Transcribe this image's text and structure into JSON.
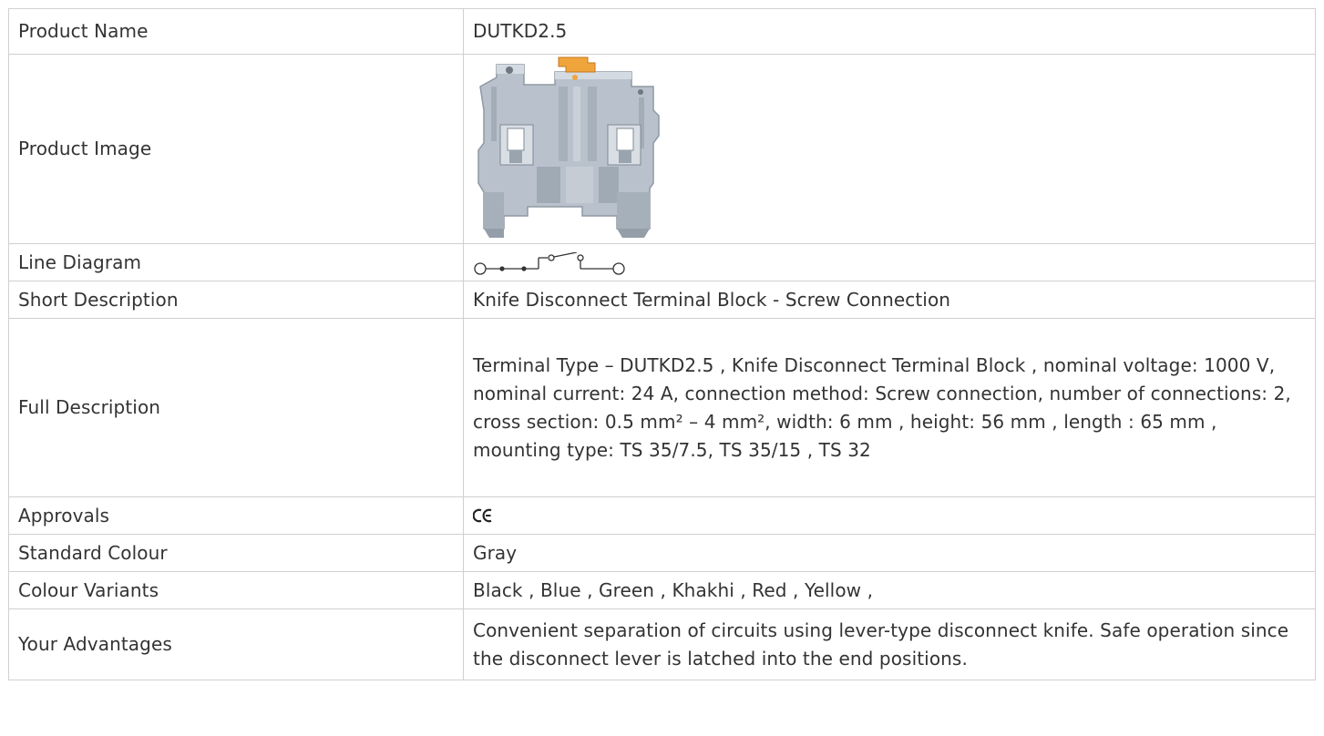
{
  "rows": [
    {
      "label": "Product Name",
      "value": "DUTKD2.5"
    },
    {
      "label": "Product Image"
    },
    {
      "label": "Line Diagram",
      "icon": "knife-disconnect-line-diagram-icon"
    },
    {
      "label": "Short Description",
      "value": "Knife Disconnect Terminal Block - Screw Connection"
    },
    {
      "label": "Full Description",
      "value": "Terminal Type – DUTKD2.5 , Knife Disconnect Terminal Block , nominal voltage: 1000 V, nominal current: 24 A, connection method: Screw connection, number of connections: 2, cross section: 0.5 mm² – 4 mm², width: 6 mm , height: 56 mm , length : 65 mm , mounting type: TS 35/7.5,  TS 35/15 , TS 32"
    },
    {
      "label": "Approvals",
      "icon": "ce-mark-icon"
    },
    {
      "label": "Standard Colour",
      "value": "Gray"
    },
    {
      "label": "Colour Variants",
      "value": "Black , Blue , Green , Khakhi , Red , Yellow ,"
    },
    {
      "label": "Your Advantages",
      "value": "Convenient separation of circuits using lever-type disconnect knife. Safe operation since the disconnect lever is latched into the end positions."
    }
  ],
  "colors": {
    "border": "#d0d0d0",
    "text": "#333333",
    "product_body": "#b9c2cc",
    "lever": "#f0a43c"
  }
}
